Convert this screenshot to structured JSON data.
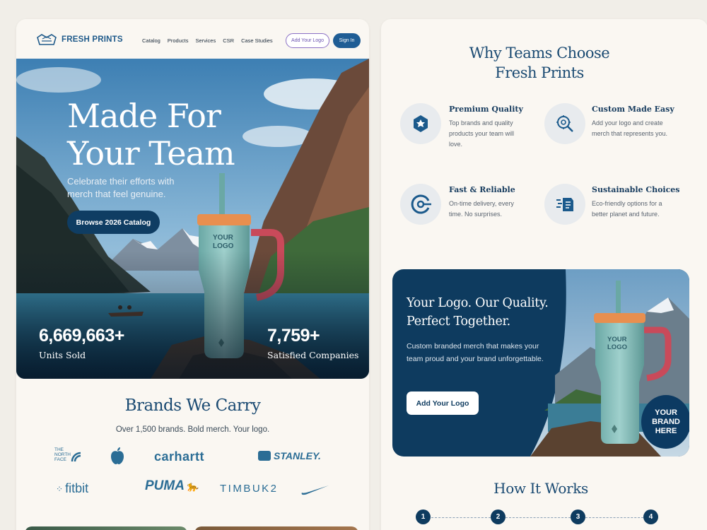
{
  "nav": {
    "brand": "FRESH PRINTS",
    "menu": [
      "Catalog",
      "Products",
      "Services",
      "CSR",
      "Case Studies"
    ],
    "add_logo_label": "Add Your Logo",
    "sign_in_label": "Sign In"
  },
  "hero": {
    "title_line1": "Made For",
    "title_line2": "Your Team",
    "subtitle": "Celebrate their efforts with merch that feel genuine.",
    "cta": "Browse 2026 Catalog",
    "mug_text_line1": "YOUR",
    "mug_text_line2": "LOGO",
    "stats": [
      {
        "value": "6,669,663+",
        "label": "Units Sold"
      },
      {
        "value": "7,759+",
        "label": "Satisfied Companies"
      }
    ]
  },
  "brands": {
    "title": "Brands We Carry",
    "subtitle": "Over 1,500 brands. Bold merch. Your logo.",
    "logos": [
      "THE NORTH FACE",
      "apple-logo-icon",
      "carhartt",
      "STANLEY.",
      "fitbit",
      "PUMA",
      "TIMBUK2",
      "nike-swoosh-icon"
    ],
    "north_face_line1": "THE",
    "north_face_line2": "NORTH",
    "north_face_line3": "FACE"
  },
  "why": {
    "title_line1": "Why Teams Choose",
    "title_line2": "Fresh Prints",
    "features": [
      {
        "title": "Premium Quality",
        "desc": "Top brands and quality products your team will love.",
        "icon": "box-star-icon"
      },
      {
        "title": "Custom Made Easy",
        "desc": "Add your logo and create merch that represents you.",
        "icon": "magnifier-gear-icon"
      },
      {
        "title": "Fast & Reliable",
        "desc": "On-time delivery, every time. No surprises.",
        "icon": "fast-delivery-icon"
      },
      {
        "title": "Sustainable Choices",
        "desc": "Eco-friendly options for a better planet and future.",
        "icon": "eco-clothing-icon"
      }
    ]
  },
  "promo": {
    "title_line1": "Your Logo. Our Quality.",
    "title_line2": "Perfect Together.",
    "desc": "Custom branded merch that makes your team proud and your brand unforgettable.",
    "cta": "Add Your Logo",
    "badge_line1": "YOUR",
    "badge_line2": "BRAND",
    "badge_line3": "HERE",
    "mug_text_line1": "YOUR",
    "mug_text_line2": "LOGO"
  },
  "how": {
    "title": "How It Works",
    "steps": [
      "1",
      "2",
      "3",
      "4"
    ]
  },
  "colors": {
    "navy": "#0e3b5f",
    "accent_blue": "#1f5d95",
    "mug_teal": "#7fb8b3",
    "mug_handle": "#c94a5a",
    "page_bg": "#f1eee8"
  }
}
